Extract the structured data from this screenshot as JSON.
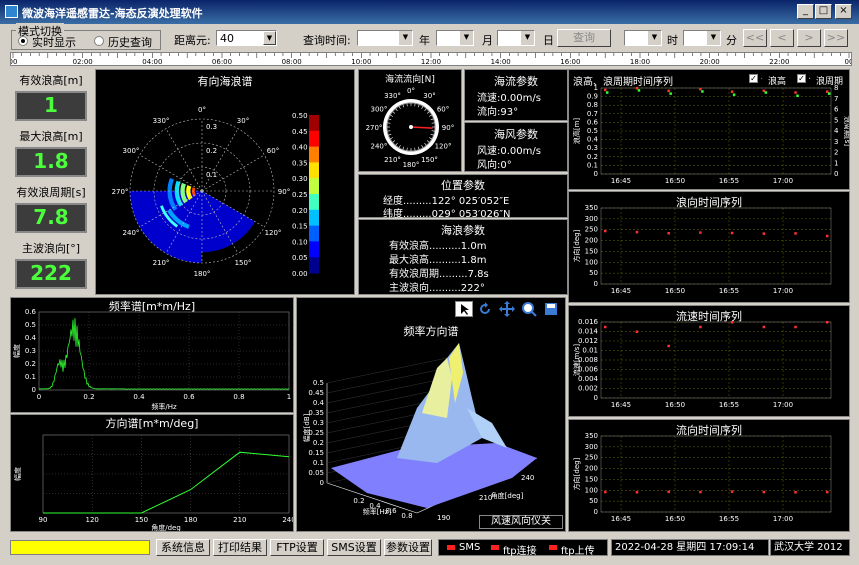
{
  "window": {
    "title": "微波海洋遥感雷达-海态反演处理软件"
  },
  "mode": {
    "group_label": "模式切换",
    "realtime": "实时显示",
    "history": "历史查询"
  },
  "query": {
    "range_label": "距离元:",
    "range_value": "40",
    "time_label": "查询时间:",
    "year": "年",
    "month": "月",
    "day": "日",
    "query_btn": "查询",
    "hour": "时",
    "minute": "分",
    "nav": [
      "<<",
      "<",
      ">",
      ">>"
    ]
  },
  "timeline": {
    "ticks": [
      "00",
      "02:00",
      "04:00",
      "06:00",
      "08:00",
      "10:00",
      "12:00",
      "14:00",
      "16:00",
      "18:00",
      "20:00",
      "22:00",
      "00"
    ]
  },
  "lcd": [
    {
      "label": "有效浪高[m]",
      "value": "1"
    },
    {
      "label": "最大浪高[m]",
      "value": "1.8"
    },
    {
      "label": "有效浪周期[s]",
      "value": "7.8"
    },
    {
      "label": "主波浪向[°]",
      "value": "222"
    }
  ],
  "polar": {
    "title": "有向海浪谱",
    "angles": [
      "0°",
      "30°",
      "60°",
      "90°",
      "120°",
      "150°",
      "180°",
      "210°",
      "240°",
      "270°",
      "300°",
      "330°"
    ],
    "radii": [
      "0.1",
      "0.2",
      "0.3"
    ],
    "colorbar": [
      "0.50",
      "0.45",
      "0.40",
      "0.35",
      "0.30",
      "0.25",
      "0.20",
      "0.15",
      "0.10",
      "0.05",
      "0.00"
    ]
  },
  "compass": {
    "title": "海流流向[N]",
    "angles": [
      "0°",
      "30°",
      "60°",
      "90°",
      "120°",
      "150°",
      "180°",
      "210°",
      "240°",
      "270°",
      "300°",
      "330°"
    ]
  },
  "current": {
    "title": "海流参数",
    "speed": "流速:0.00m/s",
    "dir": "流向:93°"
  },
  "wind": {
    "title": "海风参数",
    "speed": "风速:0.00m/s",
    "dir": "风向:0°"
  },
  "position": {
    "title": "位置参数",
    "lon": "经度.........122° 025′052″E",
    "lat": "纬度.........029° 053′026″N"
  },
  "wave": {
    "title": "海浪参数",
    "lines": [
      "有效浪高..........1.0m",
      "最大浪高..........1.8m",
      "有效浪周期.........7.8s",
      "主波浪向..........222°"
    ]
  },
  "freq": {
    "title": "频率谱[m*m/Hz]",
    "ylabel": "幅度",
    "xlabel": "频率/Hz",
    "yticks": [
      "0.6",
      "0.5",
      "0.4",
      "0.3",
      "0.2",
      "0.1",
      "0"
    ],
    "xticks": [
      "0",
      "0.2",
      "0.4",
      "0.6",
      "0.8",
      "1"
    ]
  },
  "dirspec": {
    "title": "方向谱[m*m/deg]",
    "ylabel": "幅度",
    "xlabel": "角度/deg",
    "xticks": [
      "90",
      "120",
      "150",
      "180",
      "210",
      "240"
    ]
  },
  "d3": {
    "title": "频率方向谱",
    "zlabel": "幅度[dB]",
    "xlabel": "频率[Hz]",
    "ylabel": "角度[deg]",
    "zticks": [
      "0.5",
      "0.45",
      "0.4",
      "0.35",
      "0.3",
      "0.25",
      "0.2",
      "0.15",
      "0.1",
      "0.05",
      "0"
    ],
    "xticks": [
      "0.2",
      "0.4",
      "0.6",
      "0.8"
    ],
    "yticks": [
      "190",
      "210",
      "240"
    ],
    "footer": "风速风向仪关"
  },
  "ts": [
    {
      "title": "浪高、浪周期时间序列",
      "leg1": "浪高",
      "leg2": "浪周期",
      "yl": "浪高[m]",
      "yr": "浪周期[s]",
      "yticks": [
        "1",
        "0.9",
        "0.8",
        "0.7",
        "0.6",
        "0.5",
        "0.4",
        "0.3",
        "0.2",
        "0.1",
        "0"
      ],
      "yrticks": [
        "8",
        "7",
        "6",
        "5",
        "4",
        "3",
        "2",
        "1",
        "0"
      ],
      "xticks": [
        "16:45",
        "16:50",
        "16:55",
        "17:00"
      ]
    },
    {
      "title": "浪向时间序列",
      "yl": "方向[deg]",
      "yticks": [
        "350",
        "300",
        "250",
        "200",
        "150",
        "100",
        "50",
        "0"
      ],
      "xticks": [
        "16:45",
        "16:50",
        "16:55",
        "17:00"
      ]
    },
    {
      "title": "流速时间序列",
      "yl": "流速[m/s]",
      "yticks": [
        "0.016",
        "0.014",
        "0.012",
        "0.01",
        "0.008",
        "0.006",
        "0.004",
        "0.002",
        "0"
      ],
      "xticks": [
        "16:45",
        "16:50",
        "16:55",
        "17:00"
      ]
    },
    {
      "title": "流向时间序列",
      "yl": "方向[deg]",
      "yticks": [
        "350",
        "300",
        "250",
        "200",
        "150",
        "100",
        "50",
        "0"
      ],
      "xticks": [
        "16:45",
        "16:50",
        "16:55",
        "17:00"
      ]
    }
  ],
  "bottom": {
    "buttons": [
      "系统信息",
      "打印结果",
      "FTP设置",
      "SMS设置",
      "参数设置"
    ],
    "sms": "SMS",
    "ftp_conn": "ftp连接",
    "ftp_up": "ftp上传",
    "datetime": "2022-04-28 星期四 17:09:14",
    "org": "武汉大学 2012"
  },
  "colors": {
    "panel": "#000000",
    "green": "#4cff3c",
    "red": "#ff2020",
    "yellow": "#ffff00"
  }
}
